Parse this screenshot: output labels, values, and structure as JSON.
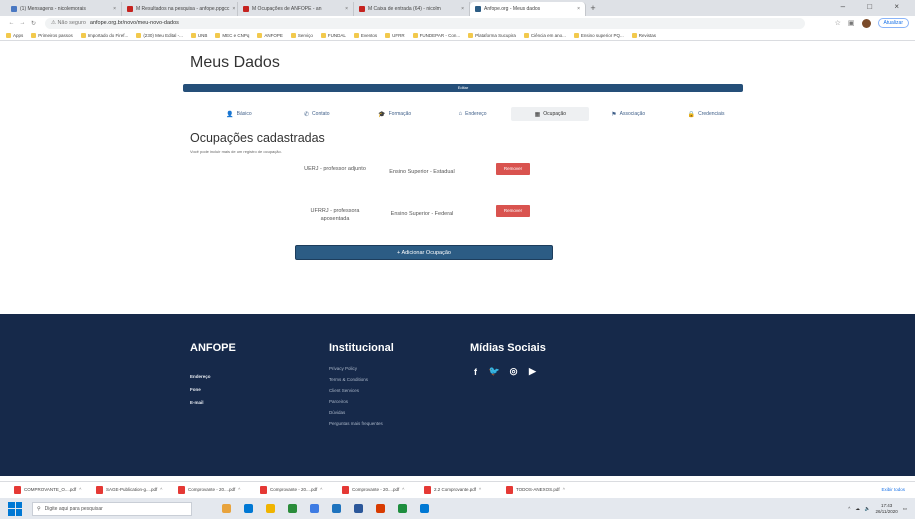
{
  "browser": {
    "tabs": [
      {
        "label": "(1) Mensagens - nicolemorais",
        "fav": "#4a78c2"
      },
      {
        "label": "M Resultados na pesquisa - anfope.ppgcc",
        "fav": "#c5221f"
      },
      {
        "label": "M Ocupações de ANFOPE - an",
        "fav": "#c5221f"
      },
      {
        "label": "M Caixa de entrada (64) - nicolm",
        "fav": "#c5221f"
      },
      {
        "label": "Anfope.org - Meus dados",
        "fav": "#2c5c84",
        "active": true
      }
    ],
    "new_tab": "+",
    "window_controls": "–  □  ×",
    "security": "⚠ Não seguro",
    "url": "anfope.org.br/novo/meu-novo-dados",
    "update_button": "Atualizar",
    "bookmarks": [
      "Apps",
      "Primeiros passos",
      "Importado do Firef...",
      "(230) Meu Edital -...",
      "UNB",
      "MEC e CNPq",
      "ANFOPE",
      "Serviço",
      "FUNDAL",
      "Eventos",
      "UFRR",
      "FUNDEPAR - Con...",
      "Plataforma Sucupira",
      "Ciência em ano...",
      "Ensino superior PQ...",
      "Revistas"
    ]
  },
  "page": {
    "title": "Meus Dados",
    "bar_label": "Editar",
    "menu": [
      {
        "label": "Básico",
        "icon": "user-icon",
        "glyph": "👤"
      },
      {
        "label": "Contato",
        "icon": "phone-icon",
        "glyph": "✆"
      },
      {
        "label": "Formação",
        "icon": "graduation-cap-icon",
        "glyph": "🎓"
      },
      {
        "label": "Endereço",
        "icon": "home-icon",
        "glyph": "⌂"
      },
      {
        "label": "Ocupação",
        "icon": "building-icon",
        "glyph": "▦",
        "active": true
      },
      {
        "label": "Associação",
        "icon": "handshake-icon",
        "glyph": "⚑"
      },
      {
        "label": "Credenciais",
        "icon": "lock-icon",
        "glyph": "🔒"
      }
    ],
    "section_title": "Ocupações cadastradas",
    "helper": "Você pode incluir mais de um registro de ocupação.",
    "occupations": [
      {
        "institution": "UERJ - professor adjunto",
        "type": "Ensino Superior - Estadual",
        "action": "Remover"
      },
      {
        "institution": "UFRRJ - professora aposentada",
        "type": "Ensino Superior - Federal",
        "action": "Remover"
      }
    ],
    "add_button": "+ Adicionar Ocupação"
  },
  "footer": {
    "col1_title": "ANFOPE",
    "col1_lines": [
      "Endereço",
      "Fone",
      "E-mail"
    ],
    "col2_title": "Institucional",
    "col2_links": [
      "Privacy Policy",
      "Terms & Conditions",
      "Client Services",
      "Parceiros",
      "Dúvidas",
      "Perguntas mais frequentes"
    ],
    "col3_title": "Mídias Sociais",
    "socials": [
      {
        "icon": "facebook-icon",
        "glyph": "f"
      },
      {
        "icon": "twitter-icon",
        "glyph": "🐦"
      },
      {
        "icon": "instagram-icon",
        "glyph": "◎"
      },
      {
        "icon": "youtube-icon",
        "glyph": "▶"
      }
    ]
  },
  "downloads": {
    "items": [
      "COMPROVANTE_O....pdf",
      "SAGE-Publication-g....pdf",
      "Comprovante - 20....pdf",
      "Comprovante - 20....pdf",
      "Comprovante - 20....pdf",
      "2.2 Comprovante.pdf",
      "TODOS-ANEXOS.pdf"
    ],
    "show_all": "Exibir todos"
  },
  "taskbar": {
    "search_placeholder": "Digite aqui para pesquisar",
    "apps": [
      "#e8a33d",
      "#0078d4",
      "#f0b400",
      "#2a8c3a",
      "#3d7be3",
      "#1e73be",
      "#2b579a",
      "#d83b01",
      "#1e8e3e",
      "#0078d4"
    ],
    "time": "17:43",
    "date": "26/11/2020"
  }
}
